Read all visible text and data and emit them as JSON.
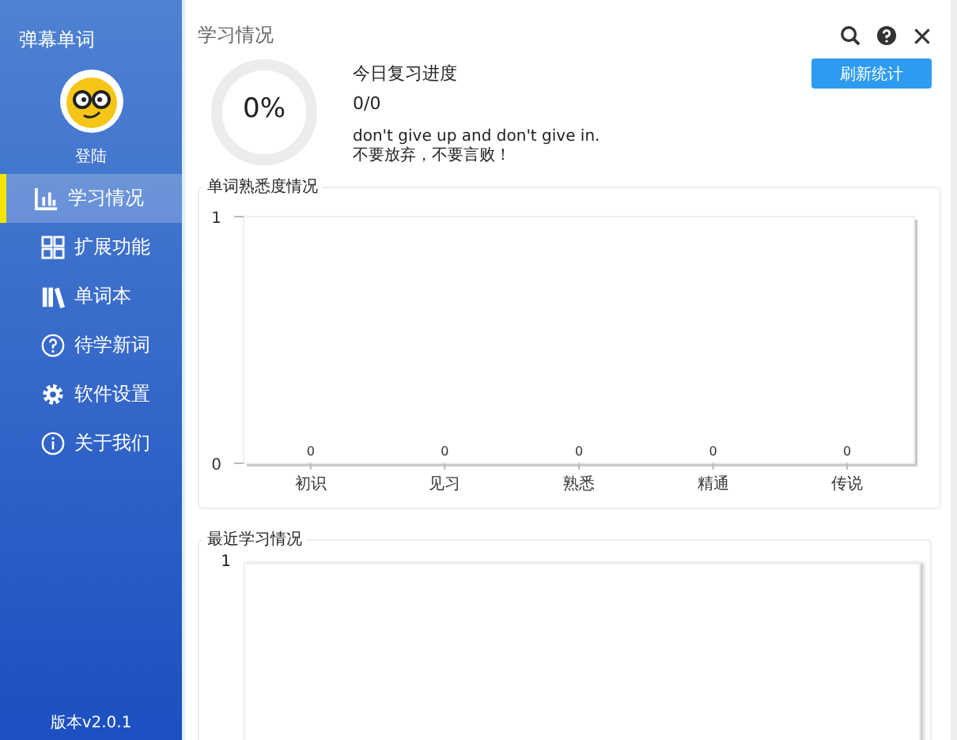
{
  "sidebar": {
    "app_title": "弹幕单词",
    "login": "登陆",
    "items": [
      {
        "label": "学习情况",
        "selected": true
      },
      {
        "label": "扩展功能",
        "selected": false
      },
      {
        "label": "单词本",
        "selected": false
      },
      {
        "label": "待学新词",
        "selected": false
      },
      {
        "label": "软件设置",
        "selected": false
      },
      {
        "label": "关于我们",
        "selected": false
      }
    ],
    "version": "版本v2.0.1"
  },
  "header": {
    "title": "学习情况"
  },
  "progress": {
    "level": 0,
    "reading": "0%",
    "heading": "今日复习进度",
    "count": "0/0",
    "motto_en": "don't give up and don't give in.",
    "motto_zh": "不要放弃，不要言败！"
  },
  "refresh_button": "刷新统计",
  "familiarity_panel": {
    "title": "单词熟悉度情况",
    "chart_data": {
      "type": "bar",
      "categories": [
        "初识",
        "见习",
        "熟悉",
        "精通",
        "传说"
      ],
      "values": [
        0,
        0,
        0,
        0,
        0
      ],
      "ylim": [
        0,
        1
      ],
      "yticks": [
        0,
        1
      ],
      "data_labels": true
    }
  },
  "recent_panel": {
    "title": "最近学习情况",
    "y_tick": "1"
  }
}
